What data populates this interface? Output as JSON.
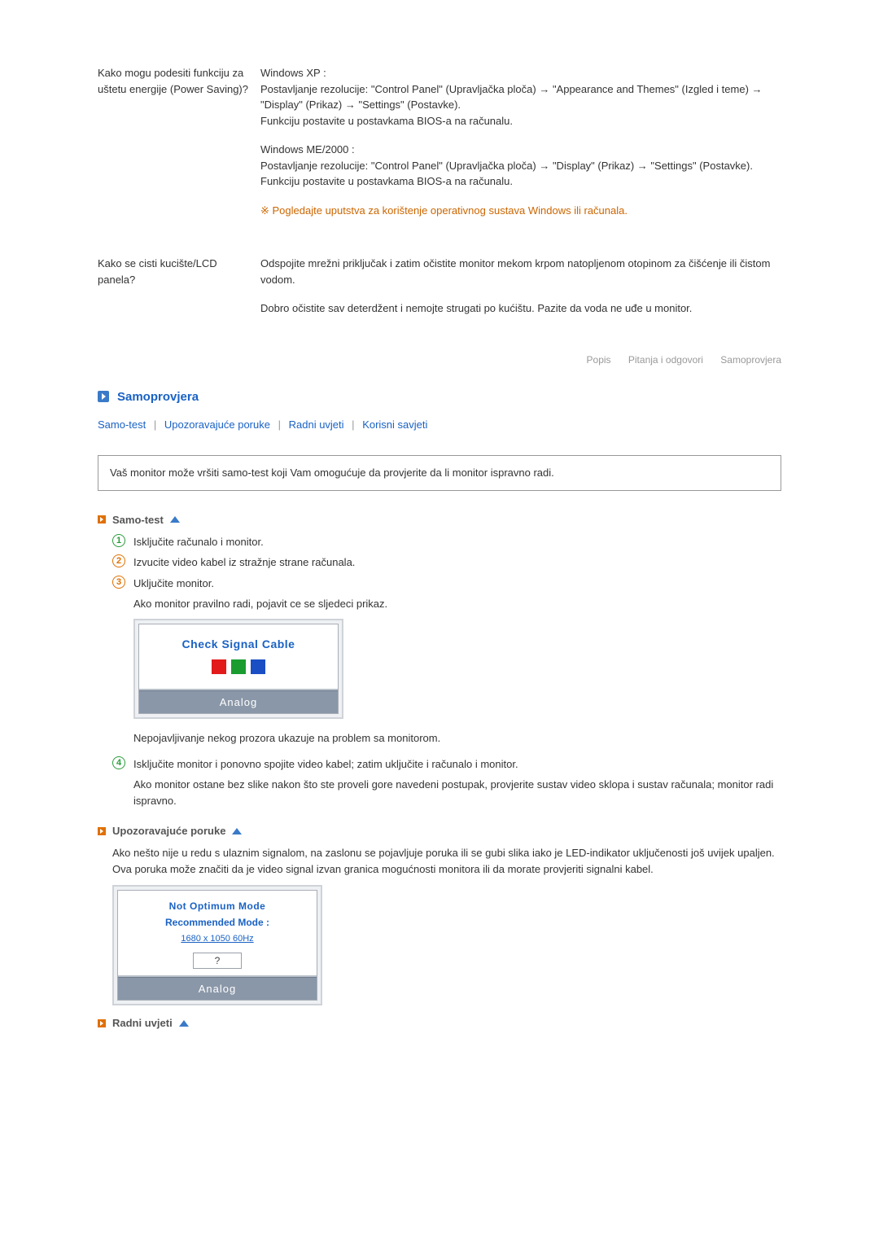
{
  "qa": [
    {
      "q": "Kako mogu podesiti funkciju za uštetu energije (Power Saving)?",
      "a": {
        "xpTitle": "Windows XP :",
        "xp1": "Postavljanje rezolucije: \"Control Panel\" (Upravljačka ploča) → \"Appearance and Themes\" (Izgled i teme) → \"Display\" (Prikaz) → \"Settings\" (Postavke).",
        "xp2": "Funkciju postavite u postavkama BIOS-a na računalu.",
        "meTitle": "Windows ME/2000 :",
        "me1": "Postavljanje rezolucije: \"Control Panel\" (Upravljačka ploča) → \"Display\" (Prikaz) → \"Settings\" (Postavke).",
        "me2": "Funkciju postavite u postavkama BIOS-a na računalu.",
        "note": "Pogledajte uputstva za korištenje operativnog sustava Windows ili računala."
      }
    },
    {
      "q": "Kako se cisti kucište/LCD panela?",
      "a": {
        "p1": "Odspojite mrežni priključak i zatim očistite monitor mekom krpom natopljenom otopinom za čišćenje ili čistom vodom.",
        "p2": "Dobro očistite sav deterdžent i nemojte strugati po kućištu. Pazite da voda ne uđe u monitor."
      }
    }
  ],
  "tabs": {
    "t1": "Popis",
    "t2": "Pitanja i odgovori",
    "t3": "Samoprovjera"
  },
  "section": "Samoprovjera",
  "anchors": {
    "a1": "Samo-test",
    "a2": "Upozoravajuće poruke",
    "a3": "Radni uvjeti",
    "a4": "Korisni savjeti"
  },
  "intro": "Vaš monitor može vršiti samo-test koji Vam omogućuje da provjerite da li monitor ispravno radi.",
  "samotest": {
    "head": "Samo-test",
    "s1": "Isključite računalo i monitor.",
    "s2": "Izvucite video kabel iz stražnje strane računala.",
    "s3a": "Uključite monitor.",
    "s3b": "Ako monitor pravilno radi, pojavit ce se sljedeci prikaz.",
    "osd": {
      "title": "Check Signal Cable",
      "footer": "Analog"
    },
    "after": "Nepojavljivanje nekog prozora ukazuje na problem sa monitorom.",
    "s4a": "Isključite monitor i ponovno spojite video kabel; zatim uključite i računalo i monitor.",
    "s4b": "Ako monitor ostane bez slike nakon što ste proveli gore navedeni postupak, provjerite sustav video sklopa i sustav računala; monitor radi ispravno."
  },
  "warn": {
    "head": "Upozoravajuće poruke",
    "body": "Ako nešto nije u redu s ulaznim signalom, na zaslonu se pojavljuje poruka ili se gubi slika iako je LED-indikator uključenosti još uvijek upaljen. Ova poruka može značiti da je video signal izvan granica mogućnosti monitora ili da morate provjeriti signalni kabel.",
    "osd": {
      "l1": "Not Optimum Mode",
      "l2": "Recommended Mode :",
      "l3": "1680 x 1050   60Hz",
      "q": "?",
      "footer": "Analog"
    }
  },
  "env": {
    "head": "Radni uvjeti"
  }
}
